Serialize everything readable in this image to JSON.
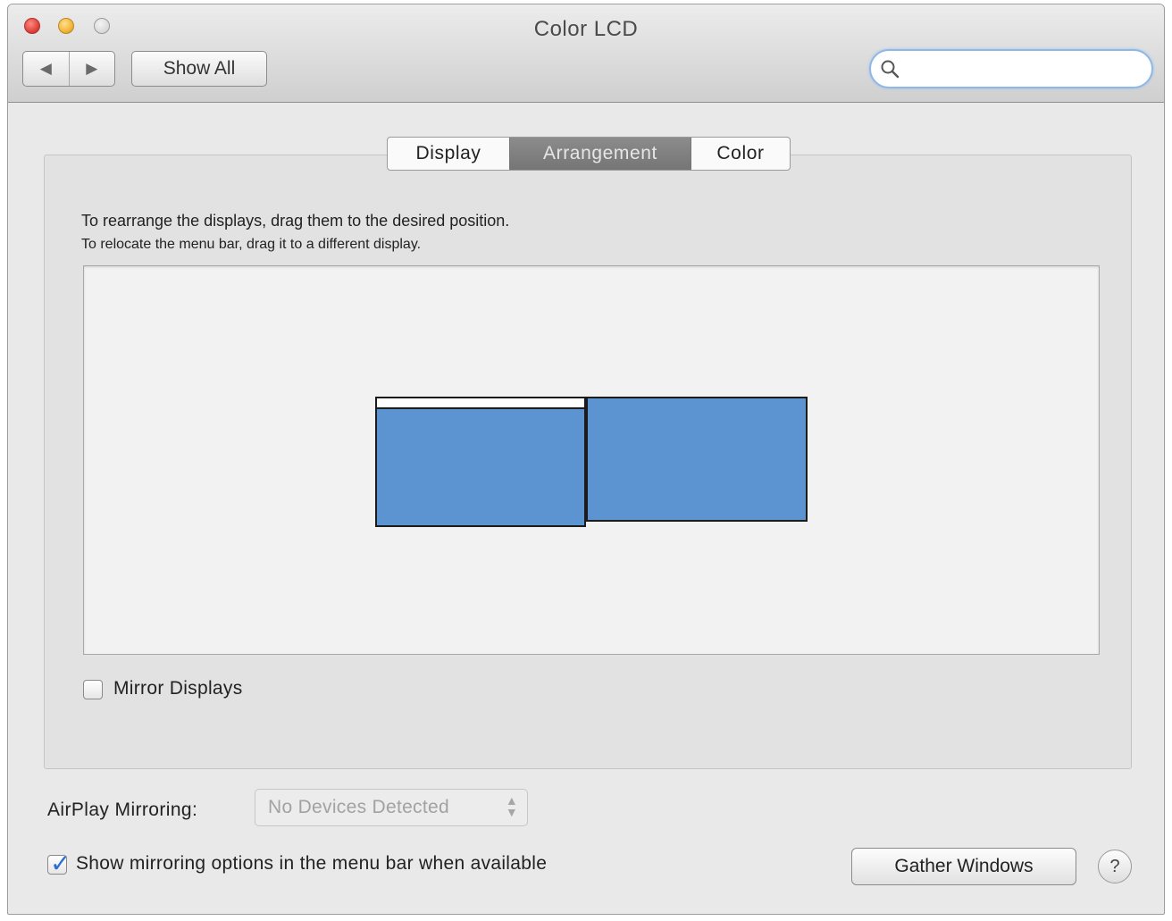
{
  "window": {
    "title": "Color LCD"
  },
  "toolbar": {
    "back_glyph": "◀",
    "forward_glyph": "▶",
    "show_all_label": "Show All",
    "search_placeholder": ""
  },
  "tabs": [
    {
      "label": "Display"
    },
    {
      "label": "Arrangement",
      "selected": true
    },
    {
      "label": "Color"
    }
  ],
  "arrangement": {
    "instruction_1": "To rearrange the displays, drag them to the desired position.",
    "instruction_2": "To relocate the menu bar, drag it to a different display.",
    "display_color": "#5b94d1",
    "mirror_displays": {
      "label": "Mirror Displays",
      "checked": false
    }
  },
  "airplay": {
    "label": "AirPlay Mirroring:",
    "selected_value": "No Devices Detected"
  },
  "show_mirroring": {
    "label": "Show mirroring options in the menu bar when available",
    "checked": true
  },
  "buttons": {
    "gather_windows": "Gather Windows",
    "help": "?"
  }
}
